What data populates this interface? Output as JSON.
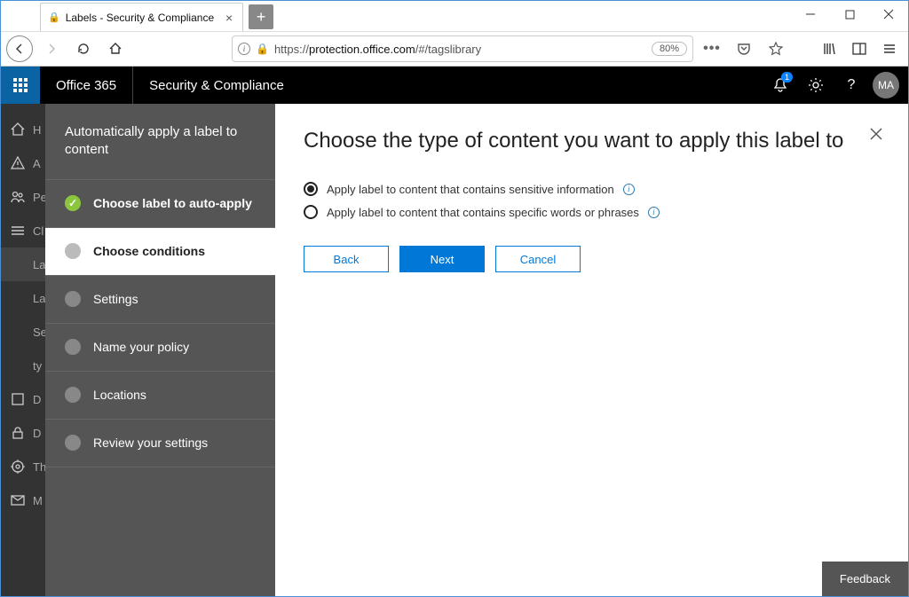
{
  "browser": {
    "tab_title": "Labels - Security & Compliance",
    "url_domain": "protection.office.com",
    "url_path": "/#/tagslibrary",
    "url_prefix": "https://",
    "zoom": "80%"
  },
  "topbar": {
    "brand": "Office 365",
    "product": "Security & Compliance",
    "notification_count": "1",
    "avatar_initials": "MA"
  },
  "bgnav": {
    "items": [
      {
        "icon": "home",
        "label": "H"
      },
      {
        "icon": "alert",
        "label": "A"
      },
      {
        "icon": "people",
        "label": "Pe"
      },
      {
        "icon": "class",
        "label": "Cl"
      },
      {
        "icon": "labels",
        "label": "La"
      },
      {
        "icon": "labelp",
        "label": "La"
      },
      {
        "icon": "sens",
        "label": "Se"
      },
      {
        "icon": "types",
        "label": "ty"
      },
      {
        "icon": "data",
        "label": "D"
      },
      {
        "icon": "lock",
        "label": "D"
      },
      {
        "icon": "threat",
        "label": "Th"
      },
      {
        "icon": "mail",
        "label": "M"
      }
    ]
  },
  "wizard": {
    "title": "Automatically apply a label to content",
    "steps": [
      {
        "label": "Choose label to auto-apply",
        "state": "done"
      },
      {
        "label": "Choose conditions",
        "state": "active"
      },
      {
        "label": "Settings",
        "state": "todo"
      },
      {
        "label": "Name your policy",
        "state": "todo"
      },
      {
        "label": "Locations",
        "state": "todo"
      },
      {
        "label": "Review your settings",
        "state": "todo"
      }
    ]
  },
  "panel": {
    "heading": "Choose the type of content you want to apply this label to",
    "options": [
      {
        "label": "Apply label to content that contains sensitive information",
        "checked": true
      },
      {
        "label": "Apply label to content that contains specific words or phrases",
        "checked": false
      }
    ],
    "buttons": {
      "back": "Back",
      "next": "Next",
      "cancel": "Cancel"
    }
  },
  "feedback_label": "Feedback"
}
